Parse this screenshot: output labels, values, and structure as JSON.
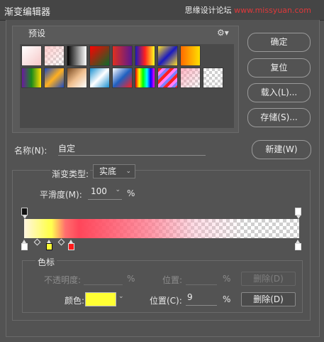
{
  "window": {
    "title": "渐变编辑器"
  },
  "watermark": {
    "left": "思缘设计论坛",
    "right": "www.missyuan.com"
  },
  "presets": {
    "label": "预设",
    "menu_icon": "gear-icon",
    "swatches_row1": [
      "linear-gradient(135deg,#ffffff,#f6c8c8)",
      "checker-fade",
      "linear-gradient(to right,#000000,#ffffff)",
      "linear-gradient(135deg,#ff0000,#0a6b2a)",
      "linear-gradient(to right,#e03020,#5a1890)",
      "linear-gradient(to right,#1a1ac0,#ff2020,#ffff20)",
      "linear-gradient(135deg,#ffe020,#1a1ac0,#ffe020)",
      "linear-gradient(to right,#ff6a00,#ffe000)"
    ],
    "swatches_row2": [
      "linear-gradient(to right,#6a1aa0,#1a8a1a,#ffe000)",
      "linear-gradient(135deg,#1a4ac0,#ffb020,#1a4ac0)",
      "linear-gradient(135deg,#7a4a20,#f0c090,#ffffff)",
      "linear-gradient(135deg,#1a90d0,#ffffff,#1a90d0)",
      "linear-gradient(135deg,#ffffff,#2060c0,#ff2020)",
      "linear-gradient(to right,#ff0000,#ffff00,#00ff00,#00ffff,#0000ff,#ff00ff)",
      "repeating-linear-gradient(135deg,#ff2020 0 4px,#ff80ff 4px 8px,#8080ff 8px 12px)",
      "checker-rose",
      "checker"
    ]
  },
  "buttons": {
    "ok": "确定",
    "reset": "复位",
    "load": "载入(L)...",
    "save": "存储(S)...",
    "new": "新建(W)"
  },
  "name": {
    "label": "名称(N):",
    "value": "自定"
  },
  "gradient_type": {
    "label": "渐变类型:",
    "value": "实底"
  },
  "smoothness": {
    "label": "平滑度(M):",
    "value": "100",
    "unit": "%"
  },
  "gradient_bar": {
    "color_stops": [
      {
        "color": "#ffffff",
        "location": 0
      },
      {
        "color": "#ffff33",
        "location": 9
      },
      {
        "color": "#ff1a1a",
        "location": 17
      }
    ]
  },
  "color_stops_panel": {
    "label": "色标",
    "opacity_label": "不透明度:",
    "opacity_unit": "%",
    "opacity_location_label": "位置:",
    "opacity_location_unit": "%",
    "opacity_delete": "删除(D)",
    "color_label": "颜色:",
    "color_value": "#ffff33",
    "color_location_label": "位置(C):",
    "color_location_value": "9",
    "color_location_unit": "%",
    "color_delete": "删除(D)"
  }
}
